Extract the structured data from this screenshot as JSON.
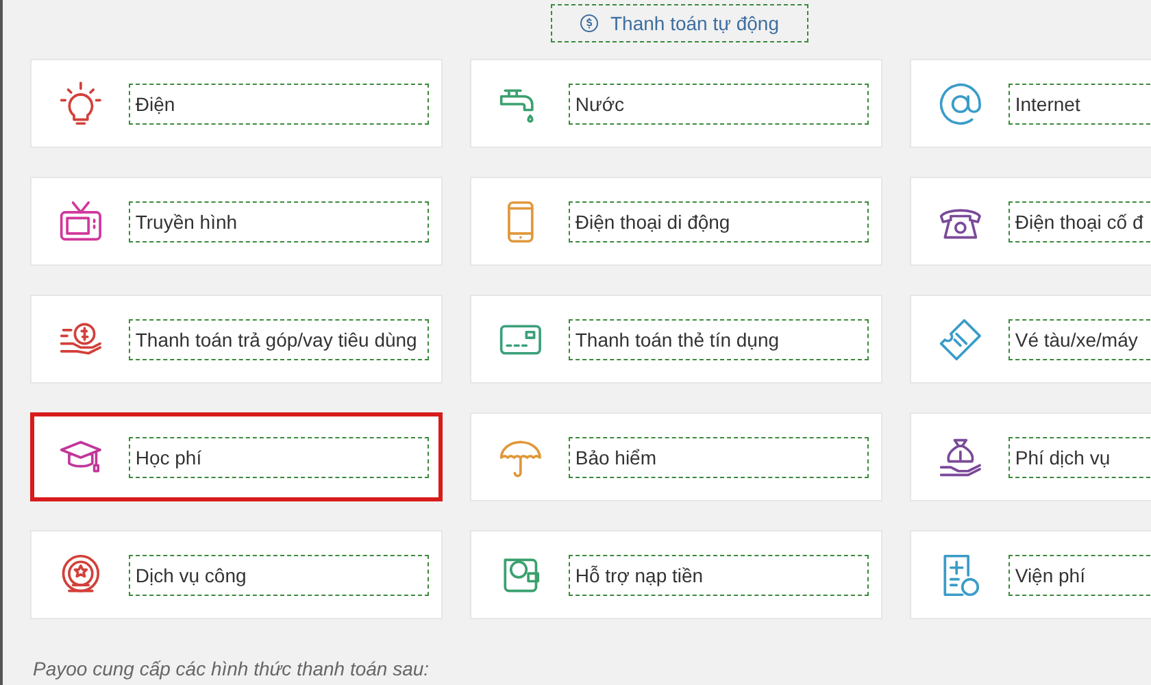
{
  "header_button": {
    "label": "Thanh toán tự động"
  },
  "services": [
    {
      "label": "Điện",
      "selected": false
    },
    {
      "label": "Nước",
      "selected": false
    },
    {
      "label": "Internet",
      "selected": false
    },
    {
      "label": "Truyền hình",
      "selected": false
    },
    {
      "label": "Điện thoại di động",
      "selected": false
    },
    {
      "label": "Điện thoại cố đ",
      "selected": false
    },
    {
      "label": "Thanh toán trả góp/vay tiêu dùng",
      "selected": false
    },
    {
      "label": "Thanh toán thẻ tín dụng",
      "selected": false
    },
    {
      "label": "Vé tàu/xe/máy",
      "selected": false
    },
    {
      "label": "Học phí",
      "selected": true
    },
    {
      "label": "Bảo hiểm",
      "selected": false
    },
    {
      "label": "Phí dịch vụ",
      "selected": false
    },
    {
      "label": "Dịch vụ công",
      "selected": false
    },
    {
      "label": "Hỗ trợ nạp tiền",
      "selected": false
    },
    {
      "label": "Viện phí",
      "selected": false
    }
  ],
  "footer_text": "Payoo cung cấp các hình thức thanh toán sau:"
}
